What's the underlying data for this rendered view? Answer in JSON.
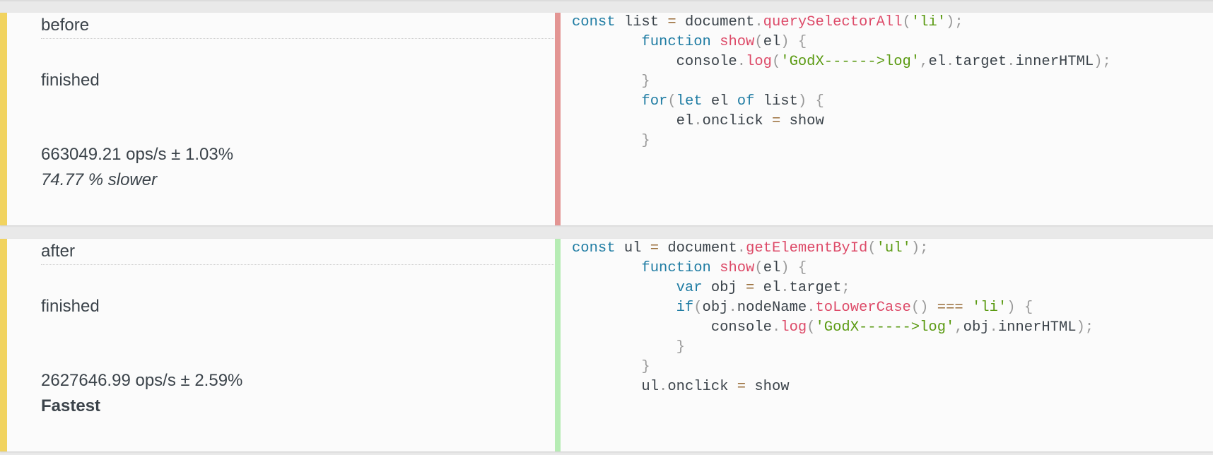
{
  "tests": [
    {
      "label": "before",
      "status": "finished",
      "ops": "663049.21 ops/s ± 1.03%",
      "verdict": "74.77 % slower",
      "code_lines": [
        "const list = document.querySelectorAll('li');",
        "        function show(el) {",
        "            console.log('GodX------>log',el.target.innerHTML);",
        "        }",
        "        for(let el of list) {",
        "            el.onclick = show",
        "        }"
      ]
    },
    {
      "label": "after",
      "status": "finished",
      "ops": "2627646.99 ops/s ± 2.59%",
      "verdict": "Fastest",
      "code_lines": [
        "const ul = document.getElementById('ul');",
        "        function show(el) {",
        "            var obj = el.target;",
        "            if(obj.nodeName.toLowerCase() === 'li') {",
        "                console.log('GodX------>log',obj.innerHTML);",
        "            }",
        "        }",
        "        ul.onclick = show"
      ]
    }
  ],
  "colors": {
    "accent": "#f1d35f",
    "slower_bar": "#e39593",
    "fastest_bar": "#b6ecb4",
    "keyword": "#1f7ca3",
    "function": "#dd4a68",
    "string": "#5a9a11"
  }
}
